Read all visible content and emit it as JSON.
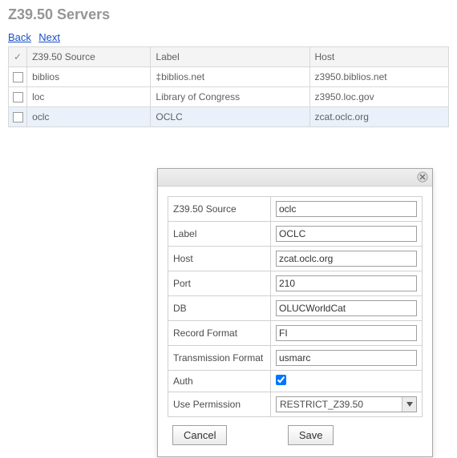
{
  "page": {
    "title": "Z39.50 Servers",
    "nav": {
      "back": "Back",
      "next": "Next"
    }
  },
  "table": {
    "headers": {
      "check": "✓",
      "source": "Z39.50 Source",
      "label": "Label",
      "host": "Host"
    },
    "rows": [
      {
        "source": "biblios",
        "label": "‡biblios.net",
        "host": "z3950.biblios.net",
        "selected": false
      },
      {
        "source": "loc",
        "label": "Library of Congress",
        "host": "z3950.loc.gov",
        "selected": false
      },
      {
        "source": "oclc",
        "label": "OCLC",
        "host": "zcat.oclc.org",
        "selected": true
      }
    ]
  },
  "dialog": {
    "labels": {
      "source": "Z39.50 Source",
      "label": "Label",
      "host": "Host",
      "port": "Port",
      "db": "DB",
      "record_format": "Record Format",
      "transmission_format": "Transmission Format",
      "auth": "Auth",
      "use_permission": "Use Permission"
    },
    "values": {
      "source": "oclc",
      "label": "OCLC",
      "host": "zcat.oclc.org",
      "port": "210",
      "db": "OLUCWorldCat",
      "record_format": "FI",
      "transmission_format": "usmarc",
      "auth_checked": true,
      "use_permission": "RESTRICT_Z39.50"
    },
    "buttons": {
      "cancel": "Cancel",
      "save": "Save"
    }
  }
}
